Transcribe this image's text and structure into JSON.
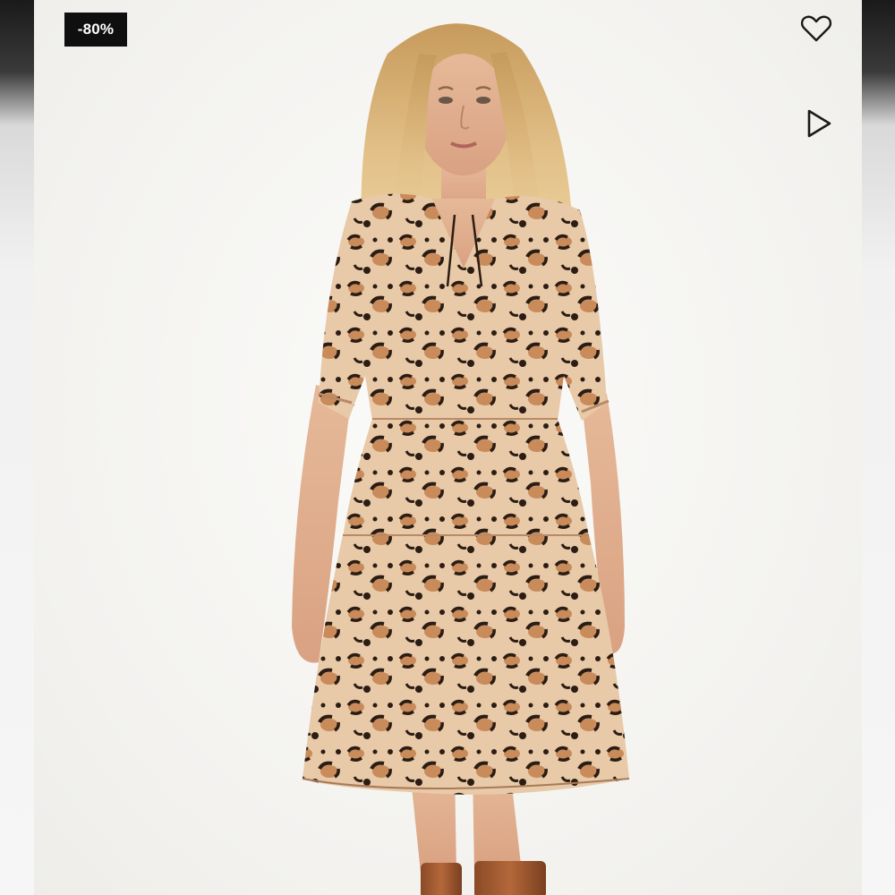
{
  "product_image": {
    "discount_badge": "-80%",
    "icons": {
      "favorite": "heart-outline-icon",
      "video": "play-outline-icon"
    },
    "colors": {
      "badge_background": "#0f0f0f",
      "badge_text": "#ffffff",
      "icon_stroke": "#1a1a1a"
    }
  }
}
